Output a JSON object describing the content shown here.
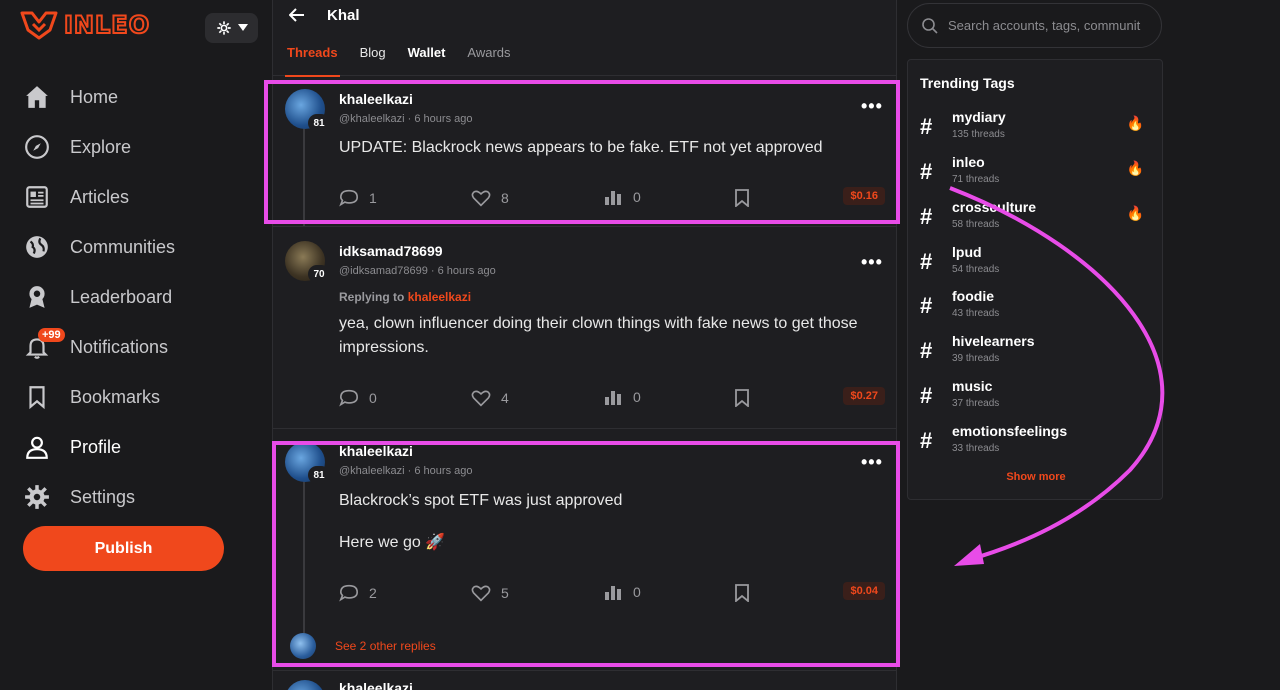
{
  "brand": {
    "name": "INLEO"
  },
  "nav": [
    {
      "label": "Home",
      "icon": "home-icon"
    },
    {
      "label": "Explore",
      "icon": "compass-icon"
    },
    {
      "label": "Articles",
      "icon": "articles-icon"
    },
    {
      "label": "Communities",
      "icon": "globe-icon"
    },
    {
      "label": "Leaderboard",
      "icon": "award-icon"
    },
    {
      "label": "Notifications",
      "icon": "bell-icon",
      "badge": "+99"
    },
    {
      "label": "Bookmarks",
      "icon": "bookmark-icon"
    },
    {
      "label": "Profile",
      "icon": "user-icon"
    },
    {
      "label": "Settings",
      "icon": "gear-icon"
    }
  ],
  "publish_label": "Publish",
  "header": {
    "title": "Khal"
  },
  "tabs": [
    "Threads",
    "Blog",
    "Wallet",
    "Awards"
  ],
  "posts": [
    {
      "username": "khaleelkazi",
      "handle": "@khaleelkazi",
      "time": "6 hours ago",
      "reputation": "81",
      "content": "UPDATE: Blackrock news appears to be fake. ETF not yet approved",
      "comments": "1",
      "likes": "8",
      "views": "0",
      "payout": "$0.16"
    },
    {
      "username": "idksamad78699",
      "handle": "@idksamad78699",
      "time": "6 hours ago",
      "reputation": "70",
      "replying_prefix": "Replying to",
      "replying_to": "khaleelkazi",
      "content": "yea, clown influencer doing their clown things with fake news to get those impressions.",
      "comments": "0",
      "likes": "4",
      "views": "0",
      "payout": "$0.27"
    },
    {
      "username": "khaleelkazi",
      "handle": "@khaleelkazi",
      "time": "6 hours ago",
      "reputation": "81",
      "content_line1": "Blackrock’s spot ETF was just approved",
      "content_line2": "Here we go 🚀",
      "comments": "2",
      "likes": "5",
      "views": "0",
      "payout": "$0.04",
      "see_more": "See 2 other replies"
    },
    {
      "username": "khaleelkazi"
    }
  ],
  "search": {
    "placeholder": "Search accounts, tags, communit"
  },
  "trending": {
    "title": "Trending Tags",
    "tags": [
      {
        "name": "mydiary",
        "count": "135 threads",
        "hot": true
      },
      {
        "name": "inleo",
        "count": "71 threads",
        "hot": true
      },
      {
        "name": "crossculture",
        "count": "58 threads",
        "hot": true
      },
      {
        "name": "lpud",
        "count": "54 threads",
        "hot": false
      },
      {
        "name": "foodie",
        "count": "43 threads",
        "hot": false
      },
      {
        "name": "hivelearners",
        "count": "39 threads",
        "hot": false
      },
      {
        "name": "music",
        "count": "37 threads",
        "hot": false
      },
      {
        "name": "emotionsfeelings",
        "count": "33 threads",
        "hot": false
      }
    ],
    "show_more": "Show more"
  },
  "colors": {
    "accent": "#f0481c",
    "highlight": "#e84ce8"
  }
}
